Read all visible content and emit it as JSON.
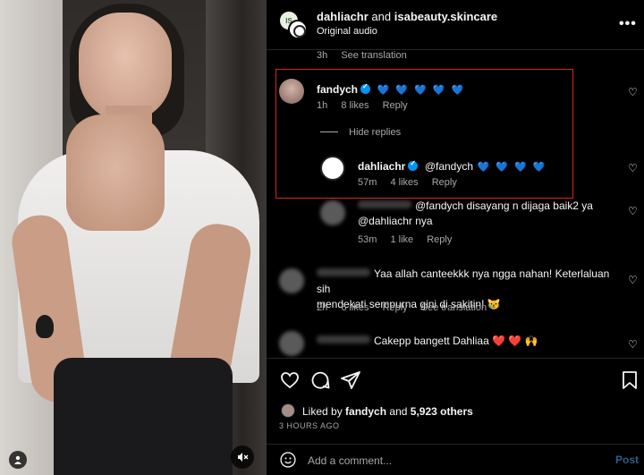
{
  "header": {
    "user_one": "dahliachr",
    "joiner": "and",
    "user_two": "isabeauty.skincare",
    "audio": "Original audio",
    "avatar_badge": "IS",
    "more_icon": "more-horizontal-icon"
  },
  "top_meta": {
    "time": "3h",
    "translation": "See translation"
  },
  "comments": [
    {
      "user": "fandych",
      "verified": true,
      "hearts": "💙 💙 💙 💙 💙",
      "time": "1h",
      "likes": "8 likes",
      "reply": "Reply"
    },
    {
      "user": "dahliachr",
      "verified": true,
      "mention": "@fandych",
      "hearts": "💙 💙 💙 💙",
      "time": "57m",
      "likes": "4 likes",
      "reply": "Reply"
    },
    {
      "text_line1": "@fandych disayang n dijaga baik2 ya",
      "text_line2": "@dahliachr nya",
      "time": "53m",
      "likes": "1 like",
      "reply": "Reply"
    },
    {
      "text_line1": "Yaa allah canteekkk nya ngga nahan! Keterlaluan sih",
      "text_line2": "mendekati sempurna gini di sakitin! 😿",
      "time": "2h",
      "likes": "6 likes",
      "reply": "Reply",
      "translation": "See translation"
    },
    {
      "text_line1": "Cakepp bangett Dahliaa ❤️ ❤️ 🙌"
    }
  ],
  "hide_replies": "Hide replies",
  "actions": {
    "liked_prefix": "Liked by",
    "liked_user": "fandych",
    "liked_and": "and",
    "liked_others": "5,923 others",
    "time_ago": "3 HOURS AGO"
  },
  "add_comment": {
    "placeholder": "Add a comment...",
    "post": "Post"
  },
  "colors": {
    "highlight": "#d9261c",
    "verified": "#0095f6",
    "heart_blue": "#3b8fe0"
  }
}
